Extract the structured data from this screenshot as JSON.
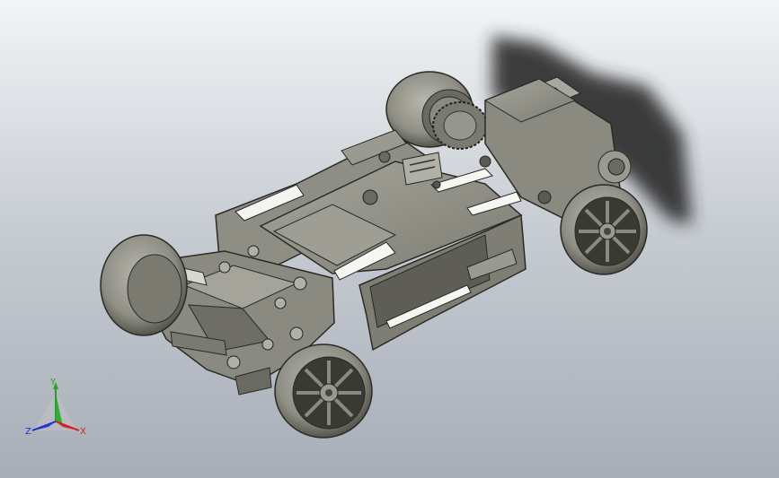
{
  "scene": {
    "background_top": "#f2f4f6",
    "background_bottom": "#a8aeb7",
    "model_color": "#8a8a80",
    "shadow_color": "#2a2a2a"
  },
  "triad": {
    "x_label": "X",
    "y_label": "Y",
    "z_label": "Z",
    "x_color": "#d42020",
    "y_color": "#2aa12a",
    "z_color": "#2030d0"
  },
  "icons": [
    "view-orientation-triad-icon",
    "chassis-3d-model"
  ]
}
